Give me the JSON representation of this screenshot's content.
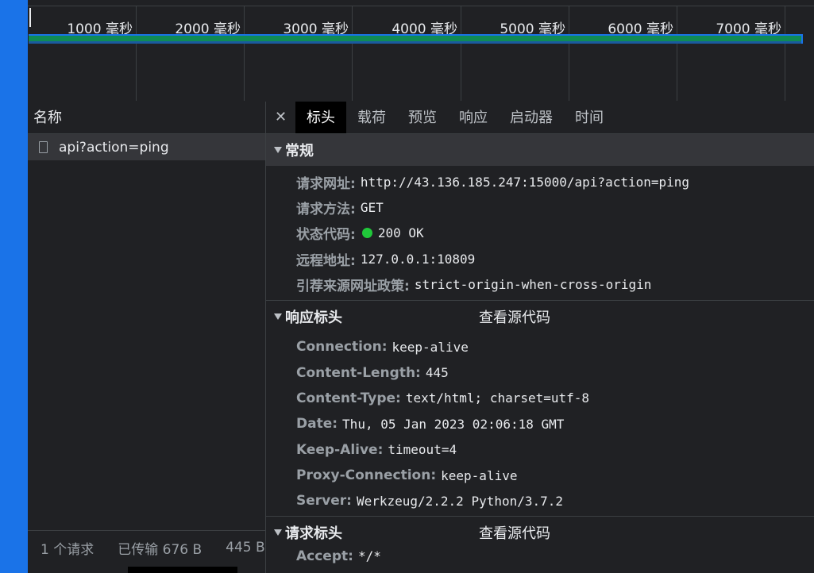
{
  "timeline": {
    "ticks": [
      "1000 毫秒",
      "2000 毫秒",
      "3000 毫秒",
      "4000 毫秒",
      "5000 毫秒",
      "6000 毫秒",
      "7000 毫秒"
    ]
  },
  "names": {
    "header": "名称",
    "row": "api?action=ping",
    "footer": {
      "requests": "1 个请求",
      "transferred": "已传输 676 B",
      "resources": "445 B"
    }
  },
  "tabs": [
    "标头",
    "载荷",
    "预览",
    "响应",
    "启动器",
    "时间"
  ],
  "active_tab": "标头",
  "general": {
    "title": "常规",
    "items": [
      {
        "k": "请求网址:",
        "v": "http://43.136.185.247:15000/api?action=ping"
      },
      {
        "k": "请求方法:",
        "v": "GET"
      },
      {
        "k": "状态代码:",
        "v": "200 OK"
      },
      {
        "k": "远程地址:",
        "v": "127.0.0.1:10809"
      },
      {
        "k": "引荐来源网址政策:",
        "v": "strict-origin-when-cross-origin"
      }
    ]
  },
  "response_headers": {
    "title": "响应标头",
    "view_source": "查看源代码",
    "items": [
      {
        "k": "Connection:",
        "v": "keep-alive"
      },
      {
        "k": "Content-Length:",
        "v": "445"
      },
      {
        "k": "Content-Type:",
        "v": "text/html; charset=utf-8"
      },
      {
        "k": "Date:",
        "v": "Thu, 05 Jan 2023 02:06:18 GMT"
      },
      {
        "k": "Keep-Alive:",
        "v": "timeout=4"
      },
      {
        "k": "Proxy-Connection:",
        "v": "keep-alive"
      },
      {
        "k": "Server:",
        "v": "Werkzeug/2.2.2 Python/3.7.2"
      }
    ]
  },
  "request_headers": {
    "title": "请求标头",
    "view_source": "查看源代码",
    "partial": {
      "k": "Accept:",
      "v": "*/*"
    }
  },
  "colors": {
    "status_ok": "#20c83a",
    "bar": "#0f8b55",
    "accent": "#1a73e8"
  }
}
